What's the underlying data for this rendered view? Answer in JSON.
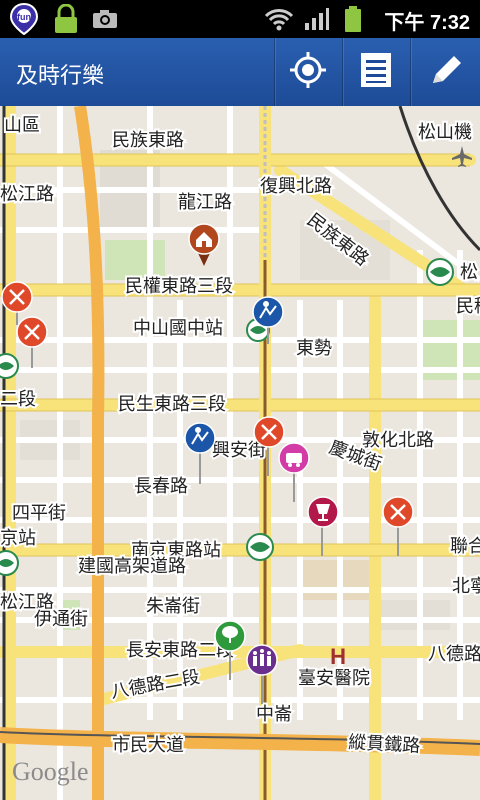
{
  "status_bar": {
    "clock": "下午 7:32"
  },
  "app_bar": {
    "title": "及時行樂",
    "actions": [
      {
        "name": "locate-icon"
      },
      {
        "name": "list-icon"
      },
      {
        "name": "edit-icon"
      }
    ]
  },
  "map": {
    "labels": {
      "district": "山區",
      "songshan": "松山機",
      "minzu_e": "民族東路",
      "minzu_e2": "民族東路",
      "fuxing_n": "復興北路",
      "minquan_e3": "民權東路三段",
      "zhongshan_jh": "中山國中站",
      "dongshi": "東勢",
      "longjiang": "龍江路",
      "songjiang": "松江路",
      "er_duan": "二段",
      "minsheng_e3": "民生東路三段",
      "xingan": "興安街",
      "changchun": "長春路",
      "qingcheng": "慶城街",
      "dunhua_n": "敦化北路",
      "siping": "四平街",
      "jing_zhan": "京站",
      "nanjing_station": "南京東路站",
      "jianguo": "建國高架道路",
      "zhuxi": "朱崙街",
      "songjiang2": "松江路",
      "yitong": "伊通街",
      "changan_e2": "長安東路二段",
      "bade_e2": "八德路二段",
      "bade_e4": "八德路",
      "zhonglun": "中崙",
      "taian_hosp": "臺安醫院",
      "civic": "市民大道",
      "railway": "縱貫鐵路",
      "song_right": "松",
      "min_right": "民稱",
      "lian": "聯合",
      "beining": "北寧路",
      "google": "Google"
    }
  }
}
